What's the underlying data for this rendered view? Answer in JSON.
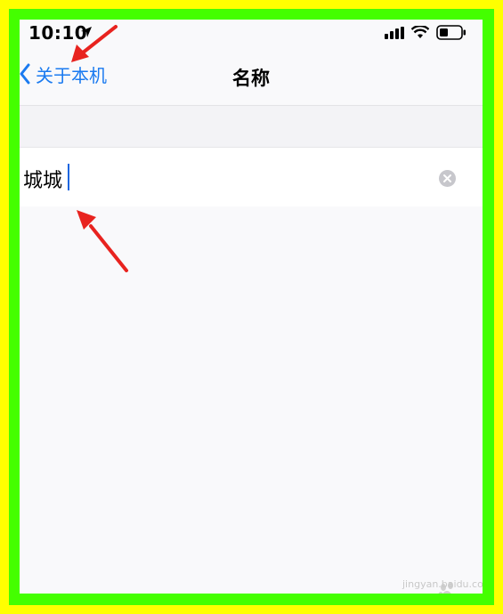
{
  "status_bar": {
    "time": "10:10"
  },
  "nav": {
    "back_label": "关于本机",
    "title": "名称"
  },
  "name_field": {
    "value": "城城"
  },
  "watermark": {
    "text": "jingyan.baidu.com"
  },
  "colors": {
    "outer_frame": "#ffff00",
    "inner_frame": "#44ff00",
    "ios_blue": "#1a7af0",
    "annotation_red": "#e8231f"
  }
}
